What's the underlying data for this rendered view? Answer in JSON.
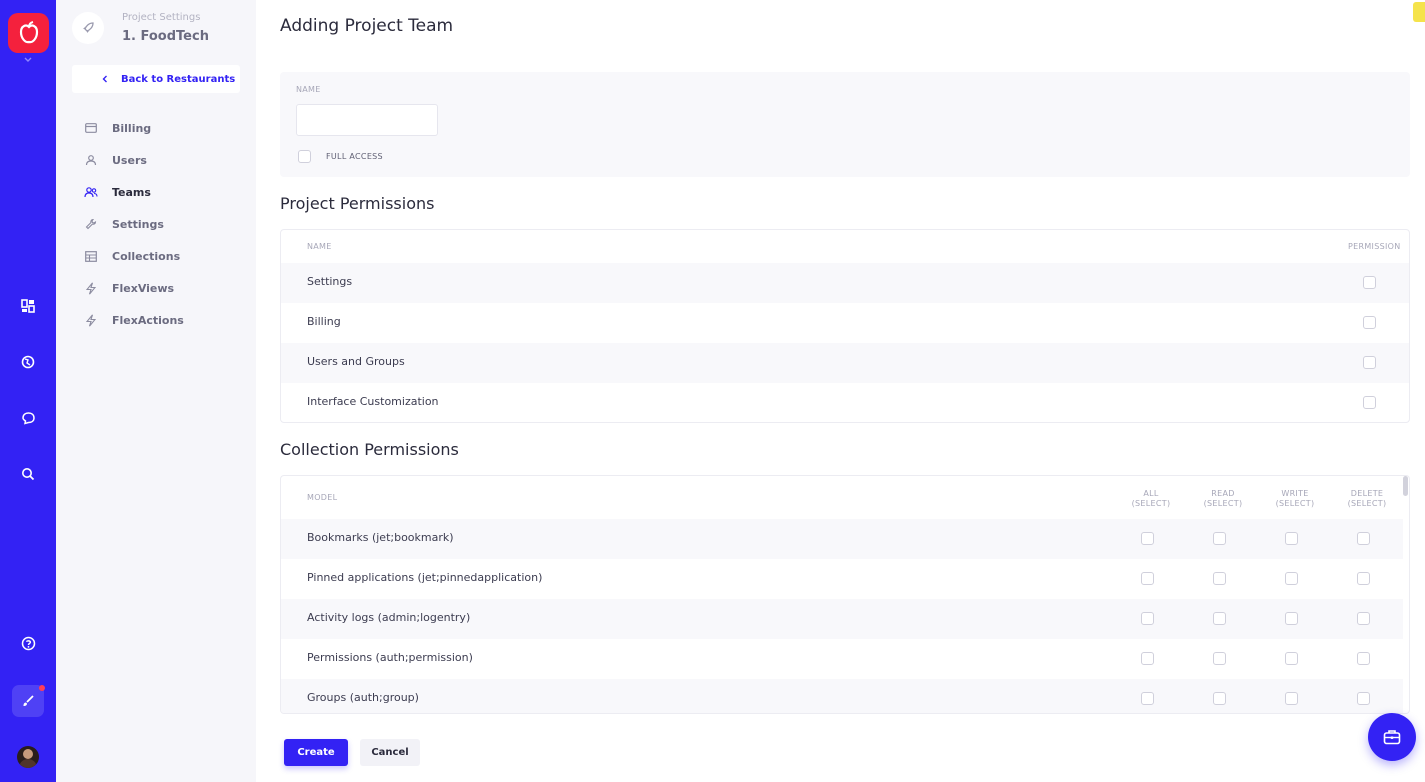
{
  "app": {
    "brand_color": "#3322f4",
    "logo_color": "#f4213d",
    "rail_icons": [
      "dashboard-icon",
      "globe-icon",
      "chat-icon",
      "search-icon",
      "help-icon",
      "brush-icon",
      "avatar"
    ]
  },
  "sidebar": {
    "subtitle": "Project Settings",
    "title": "1. FoodTech",
    "back_label": "Back to Restaurants",
    "items": [
      {
        "label": "Billing",
        "icon": "billing-icon",
        "active": false
      },
      {
        "label": "Users",
        "icon": "user-icon",
        "active": false
      },
      {
        "label": "Teams",
        "icon": "teams-icon",
        "active": true
      },
      {
        "label": "Settings",
        "icon": "wrench-icon",
        "active": false
      },
      {
        "label": "Collections",
        "icon": "table-icon",
        "active": false
      },
      {
        "label": "FlexViews",
        "icon": "bolt-icon",
        "active": false
      },
      {
        "label": "FlexActions",
        "icon": "bolt-icon",
        "active": false
      }
    ]
  },
  "main": {
    "title": "Adding Project Team",
    "form": {
      "name_label": "NAME",
      "name_value": "",
      "full_access_label": "FULL ACCESS",
      "full_access_checked": false
    },
    "project_permissions": {
      "heading": "Project Permissions",
      "col_name": "NAME",
      "col_permission": "PERMISSION",
      "rows": [
        {
          "name": "Settings",
          "checked": false
        },
        {
          "name": "Billing",
          "checked": false
        },
        {
          "name": "Users and Groups",
          "checked": false
        },
        {
          "name": "Interface Customization",
          "checked": false
        }
      ]
    },
    "collection_permissions": {
      "heading": "Collection Permissions",
      "col_model": "MODEL",
      "columns": [
        {
          "top": "ALL",
          "bottom": "(SELECT)"
        },
        {
          "top": "READ",
          "bottom": "(SELECT)"
        },
        {
          "top": "WRITE",
          "bottom": "(SELECT)"
        },
        {
          "top": "DELETE",
          "bottom": "(SELECT)"
        }
      ],
      "rows": [
        {
          "name": "Bookmarks (jet;bookmark)"
        },
        {
          "name": "Pinned applications (jet;pinnedapplication)"
        },
        {
          "name": "Activity logs (admin;logentry)"
        },
        {
          "name": "Permissions (auth;permission)"
        },
        {
          "name": "Groups (auth;group)"
        }
      ]
    },
    "buttons": {
      "create": "Create",
      "cancel": "Cancel"
    }
  }
}
